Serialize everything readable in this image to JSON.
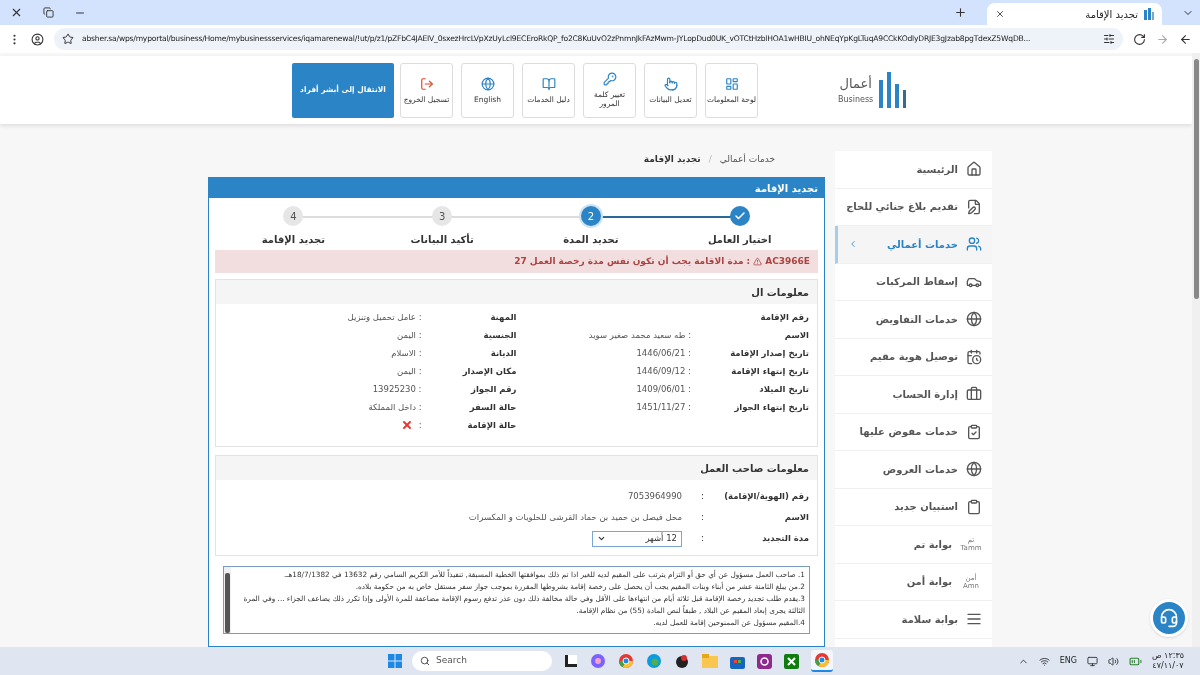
{
  "browser": {
    "tab_title": "تجديد الإقامة",
    "url": "absher.sa/wps/myportal/business/Home/mybusinessservices/iqamarenewal/!ut/p/z1/pZFbC4JAEIV_0sxezHrcLVpXzUyLcl9ECEroRkQP_fo2C8KuUvO2zPnmnJkFAzMwm-JYLopDud0UK_vOTCtHzblHOA1wHBIU_ohNEqYpKgLTuqA9CCkKOdlyDRJE3gJzab8pgTdexZ5WqDB..."
  },
  "header": {
    "logo": {
      "name": "أعمال",
      "sub": "Business"
    },
    "tiles": [
      {
        "label": "لوحة المعلومات"
      },
      {
        "label": "تعديل البيانات"
      },
      {
        "label": "تغيير كلمة المرور"
      },
      {
        "label": "دليل الخدمات"
      },
      {
        "label": "English"
      },
      {
        "label": "تسجيل الخروج"
      }
    ],
    "primary_button": "الانتقال إلى أبشر أفراد"
  },
  "breadcrumb": {
    "items": [
      "خدمات أعمالي",
      "تجديد الإقامة"
    ],
    "separator": "/"
  },
  "panel_title": "تجديد الإقامة",
  "steps": [
    {
      "label": "اختيار العامل",
      "completed": true,
      "selected": false
    },
    {
      "number": "2",
      "label": "تحديد المدة",
      "completed": false,
      "selected": true
    },
    {
      "number": "3",
      "label": "تأكيد البيانات",
      "completed": false,
      "selected": false
    },
    {
      "number": "4",
      "label": "تجديد الإقامة",
      "completed": false,
      "selected": false
    }
  ],
  "alert": {
    "code": "AC3966E",
    "message": ": مدة الاقامة يجب أن تكون نفس مدة رخصة العمل 27"
  },
  "worker_info": {
    "title": "معلومات ال",
    "columns": [
      [
        {
          "label": "رقم الإقامة"
        },
        {
          "label": "الاسم",
          "value": ": طه سعيد محمد صغير سويد"
        },
        {
          "label": "تاريخ إصدار الإقامة",
          "value": ": 1446/06/21"
        },
        {
          "label": "تاريخ إنتهاء الإقامة",
          "value": ": 1446/09/12"
        },
        {
          "label": "تاريخ الميلاد",
          "value": ": 1409/06/01"
        },
        {
          "label": "تاريخ إنتهاء الجواز",
          "value": ": 1451/11/27"
        }
      ],
      [
        {
          "label": "المهنة",
          "value": ": عامل تحميل وتنزيل"
        },
        {
          "label": "الجنسية",
          "value": ": اليمن"
        },
        {
          "label": "الديانة",
          "value": ": الاسلام"
        },
        {
          "label": "مكان الإصدار",
          "value": ": اليمن"
        },
        {
          "label": "رقم الجواز",
          "value": ": 13925230"
        },
        {
          "label": "حالة السفر",
          "value": ": داخل المملكة"
        },
        {
          "label": "حالة الإقامة",
          "value": ":",
          "valid": false
        }
      ]
    ]
  },
  "employer_info": {
    "title": "معلومات صاحب العمل",
    "fields": [
      {
        "label": "رقم (الهوية/الإقامة)",
        "colon": ":",
        "value": "7053964990",
        "kind": "text"
      },
      {
        "label": "الاسم",
        "colon": ":",
        "value": "محل فيصل بن حميد بن حماد القرشى للحلويات و المكسرات",
        "kind": "text"
      },
      {
        "label": "مدة التجديد",
        "colon": ":",
        "value": "12 أشهر",
        "kind": "select"
      }
    ]
  },
  "terms": [
    "1. صاحب العمل مسؤول عن أي حق أو التزام يترتب على المقيم لديه للغير اذا تم ذلك بموافقتها الخطية المسبقة, تنفيذاً للأمر الكريم السامي رقم 13632 في 18/7/1382هـ.",
    "2.من يبلغ الثامنة عشر من أبناء وبنات المقيم يجب أن يحصل على رخصة إقامة بشروطها المقررة بموجب جواز سفر مستقل خاص به من حكومة بلاده.",
    "3.يقدم طلب تجديد رخصة الإقامة قبل ثلاثة أيام من انتهاءها على الأقل وفي حالة مخالفة ذلك دون عذر تدفع رسوم الإقامة مضاعفة للمرة الأولى وإذا تكرر ذلك يضاعف الجزاء ... وفي المرة الثالثة يجرى إبعاد المقيم عن البلاد , طبقاً لنص المادة (55) من نظام الإقامة.",
    "4.المقيم مسؤول عن الممنوحين إقامة للعمل لديه."
  ],
  "sidebar": [
    {
      "label": "الرئيسية",
      "selected": false
    },
    {
      "label": "تقديم بلاغ جنائي للحاج",
      "selected": false
    },
    {
      "label": "خدمات أعمالي",
      "selected": true
    },
    {
      "label": "إسقاط المركبات",
      "selected": false
    },
    {
      "label": "خدمات التفاويض",
      "selected": false
    },
    {
      "label": "توصيل هوية مقيم",
      "selected": false
    },
    {
      "label": "إدارة الحساب",
      "selected": false
    },
    {
      "label": "خدمات مفوض عليها",
      "selected": false
    },
    {
      "label": "خدمات العروض",
      "selected": false
    },
    {
      "label": "استبيان جديد",
      "selected": false
    },
    {
      "label": "بوابة تم",
      "logo_lines": [
        "تم",
        "Tamm"
      ],
      "selected": false
    },
    {
      "label": "بوابة أمن",
      "logo_lines": [
        "أمن",
        "Amn"
      ],
      "selected": false
    },
    {
      "label": "بوابة سلامة",
      "selected": false
    }
  ],
  "taskbar": {
    "search_placeholder": "Search",
    "language": "ENG",
    "time": "١٢:٣٥ ص",
    "date": "٤٧/١١/٠٧"
  }
}
